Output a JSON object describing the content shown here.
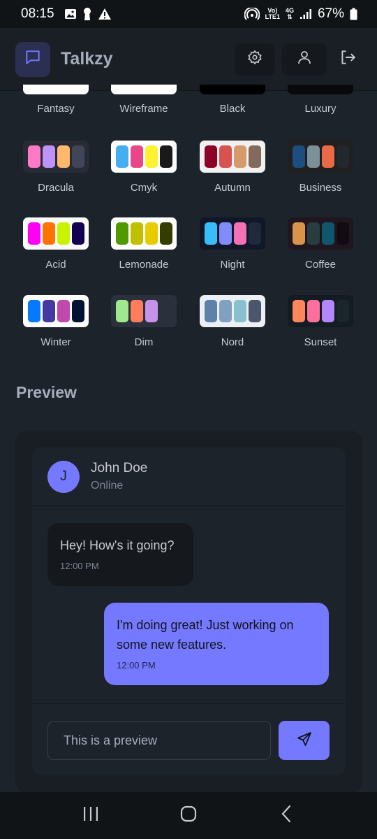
{
  "status_bar": {
    "time": "08:15",
    "battery": "67%",
    "network_top": "Vo)",
    "network_bottom": "LTE1",
    "network_type": "4G",
    "left_icons": [
      "image-icon",
      "keyhole-icon",
      "warning-icon"
    ],
    "right_icons": [
      "hotspot-icon",
      "signal-icon",
      "battery-icon"
    ]
  },
  "header": {
    "app_name": "Talkzy",
    "logo_icon": "chat-bubble-icon",
    "actions": [
      "settings-icon",
      "user-icon",
      "logout-icon"
    ],
    "accent": "#7479ff"
  },
  "themes_top": [
    "Fantasy",
    "Wireframe",
    "Black",
    "Luxury"
  ],
  "themes": [
    {
      "name": "Dracula",
      "bg": "#282a36",
      "colors": [
        "#ff79c6",
        "#bd93f9",
        "#ffb86c",
        "#414558"
      ]
    },
    {
      "name": "Cmyk",
      "bg": "#ffffff",
      "colors": [
        "#45aeee",
        "#e8488a",
        "#fff232",
        "#1a1a1a"
      ]
    },
    {
      "name": "Autumn",
      "bg": "#f1f1f1",
      "colors": [
        "#8c0327",
        "#d85251",
        "#d59b6a",
        "#826a5c"
      ]
    },
    {
      "name": "Business",
      "bg": "#202020",
      "colors": [
        "#1c4e80",
        "#7c909a",
        "#ea6947",
        "#23282e"
      ]
    },
    {
      "name": "Acid",
      "bg": "#fafafa",
      "colors": [
        "#ff00f4",
        "#ff7400",
        "#c9f400",
        "#140151"
      ]
    },
    {
      "name": "Lemonade",
      "bg": "#ffffff",
      "colors": [
        "#519903",
        "#c1c000",
        "#e7cc00",
        "#353c00"
      ]
    },
    {
      "name": "Night",
      "bg": "#0f1729",
      "colors": [
        "#38bdf8",
        "#818cf8",
        "#f471b5",
        "#1e293b"
      ]
    },
    {
      "name": "Coffee",
      "bg": "#20161f",
      "colors": [
        "#db924b",
        "#263e3f",
        "#10576d",
        "#120c12"
      ]
    },
    {
      "name": "Winter",
      "bg": "#ffffff",
      "colors": [
        "#047aff",
        "#463aa2",
        "#c148ac",
        "#021431"
      ]
    },
    {
      "name": "Dim",
      "bg": "#2a303c",
      "colors": [
        "#9fe88d",
        "#ff7d5c",
        "#c792e9",
        "#2a303c"
      ]
    },
    {
      "name": "Nord",
      "bg": "#eceff4",
      "colors": [
        "#5e81ac",
        "#81a1c1",
        "#88c0d0",
        "#4c566a"
      ]
    },
    {
      "name": "Sunset",
      "bg": "#121c22",
      "colors": [
        "#ff865b",
        "#fd6f9c",
        "#b387fa",
        "#1b262c"
      ]
    }
  ],
  "preview": {
    "heading": "Preview",
    "contact_initial": "J",
    "contact_name": "John Doe",
    "contact_status": "Online",
    "messages": [
      {
        "text": "Hey! How's it going?",
        "time": "12:00 PM",
        "sent": false
      },
      {
        "text": "I'm doing great! Just working on some new features.",
        "time": "12:00 PM",
        "sent": true
      }
    ],
    "input_value": "This is a preview",
    "send_icon": "send-icon"
  },
  "nav_bar": [
    "recent-apps-icon",
    "home-icon",
    "back-icon"
  ]
}
